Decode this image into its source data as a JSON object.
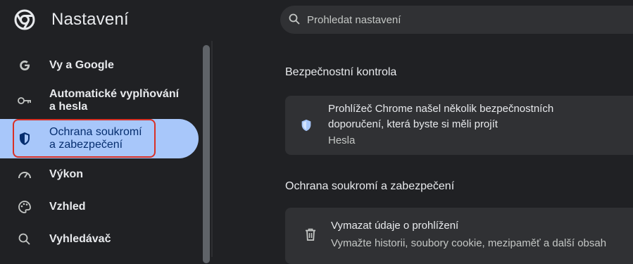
{
  "header": {
    "title": "Nastavení",
    "search_placeholder": "Prohledat nastavení"
  },
  "sidebar": {
    "items": [
      {
        "label": "Vy a Google",
        "icon": "google-icon"
      },
      {
        "label": "Automatické vyplňování\na hesla",
        "icon": "key-icon"
      },
      {
        "label": "Ochrana soukromí\na zabezpečení",
        "icon": "shield-icon",
        "active": true
      },
      {
        "label": "Výkon",
        "icon": "speedometer-icon"
      },
      {
        "label": "Vzhled",
        "icon": "palette-icon"
      },
      {
        "label": "Vyhledávač",
        "icon": "search-icon"
      }
    ]
  },
  "main": {
    "safety_check": {
      "title": "Bezpečnostní kontrola",
      "card_title": "Prohlížeč Chrome našel několik bezpečnostních doporučení, která byste si měli projít",
      "card_subtitle": "Hesla"
    },
    "privacy": {
      "title": "Ochrana soukromí a zabezpečení",
      "clear_title": "Vymazat údaje o prohlížení",
      "clear_subtitle": "Vymažte historii, soubory cookie, mezipaměť a další obsah"
    }
  },
  "colors": {
    "background": "#202124",
    "card": "#303134",
    "active_nav": "#a8c7fa",
    "highlight": "#d93025"
  }
}
